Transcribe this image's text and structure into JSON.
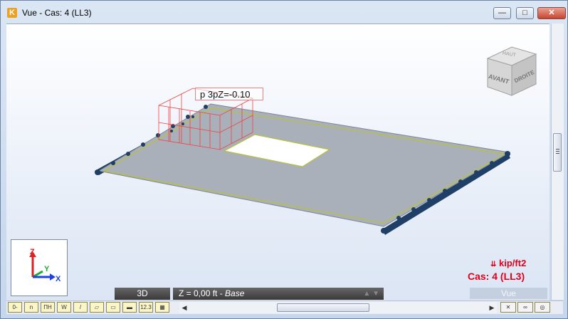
{
  "window": {
    "app_icon_letter": "K",
    "title": "Vue - Cas: 4 (LL3)",
    "min_glyph": "—",
    "max_glyph": "□",
    "close_glyph": "✕"
  },
  "view_cube": {
    "face_front": "AVANT",
    "face_right": "DROITE",
    "face_top": "HAUT"
  },
  "load_label": "p 3pZ=-0.10",
  "axes": {
    "x": "X",
    "y": "Y",
    "z": "Z"
  },
  "units_label": "kip/ft2",
  "case_label": "Cas: 4 (LL3)",
  "view_tab": "Vue",
  "bottom_bar": {
    "mode": "3D",
    "plane_prefix": "Z = 0,00 ft - ",
    "plane_name": "Base",
    "arrows": "▲ ▼"
  },
  "toolbar_buttons": [
    "0-",
    "n",
    "ПН",
    "W",
    "/",
    "▱",
    "▭",
    "▬",
    "12.3",
    "▦"
  ],
  "colors": {
    "slab": "#a9b0b9",
    "slab_edge": "#b8c23a",
    "support": "#1f3f66",
    "load": "#ee4444",
    "accent_red": "#e0001b"
  }
}
